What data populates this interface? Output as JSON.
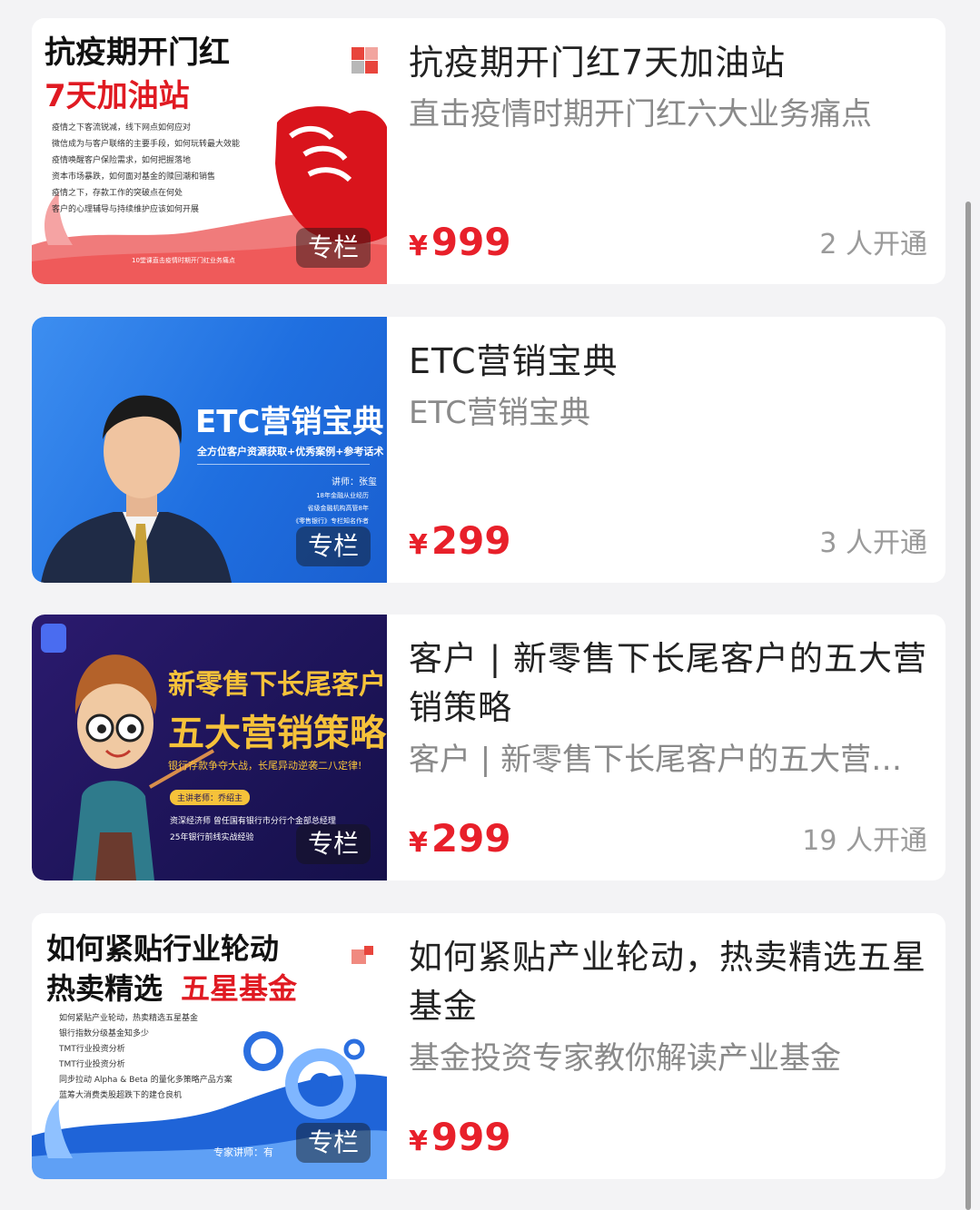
{
  "courses": [
    {
      "title": "抗疫期开门红7天加油站",
      "subtitle": "直击疫情时期开门红六大业务痛点",
      "price": "999",
      "currency": "¥",
      "subscribers": "2 人开通",
      "badge": "专栏",
      "thumb": {
        "line1": "抗疫期开门红",
        "line2": "7天加油站",
        "bullets": [
          "疫情之下客流锐减，线下网点如何应对",
          "微信成为与客户联络的主要手段，如何玩转最大效能",
          "疫情唤醒客户保险需求，如何把握落地",
          "资本市场暴跌，如何面对基金的赎回潮和销售",
          "疫情之下，存款工作的突破点在何处",
          "客户的心理辅导与持续维护应该如何开展"
        ],
        "footer": "10堂课直击疫情时期开门红业务痛点"
      }
    },
    {
      "title": "ETC营销宝典",
      "subtitle": "ETC营销宝典",
      "price": "299",
      "currency": "¥",
      "subscribers": "3 人开通",
      "badge": "专栏",
      "thumb": {
        "heading": "ETC营销宝典",
        "tagline": "全方位客户资源获取+优秀案例+参考话术",
        "lecturer": "讲师：张玺",
        "lines": [
          "18年金融从业经历",
          "省级金融机构高管8年",
          "《零售银行》专栏知名作者"
        ]
      }
    },
    {
      "title": "客户 | 新零售下长尾客户的五大营销策略",
      "subtitle": "客户 | 新零售下长尾客户的五大营…",
      "price": "299",
      "currency": "¥",
      "subscribers": "19 人开通",
      "badge": "专栏",
      "thumb": {
        "line1": "新零售下长尾客户",
        "line2": "五大营销策略",
        "tagline": "银行存款争夺大战，长尾异动逆袭二八定律!",
        "tag": "主讲老师：乔绍主",
        "lines": [
          "资深经济师  曾任国有银行市分行个金部总经理",
          "25年银行前线实战经验"
        ]
      }
    },
    {
      "title": "如何紧贴产业轮动，热卖精选五星基金",
      "subtitle": "基金投资专家教你解读产业基金",
      "price": "999",
      "currency": "¥",
      "subscribers": "",
      "badge": "专栏",
      "thumb": {
        "line1": "如何紧贴行业轮动",
        "line2a": "热卖精选",
        "line2b": "五星基金",
        "bullets": [
          "如何紧贴产业轮动，热卖精选五星基金",
          "银行指数分级基金知多少",
          "TMT行业投资分析",
          "TMT行业投资分析",
          "同步拉动 Alpha & Beta 的量化多策略产品方案",
          "蓝筹大消费类股超跌下的建仓良机"
        ],
        "footer": "专家讲师：有"
      }
    }
  ],
  "colors": {
    "price": "#e8202a",
    "accent": "#e8202a"
  }
}
